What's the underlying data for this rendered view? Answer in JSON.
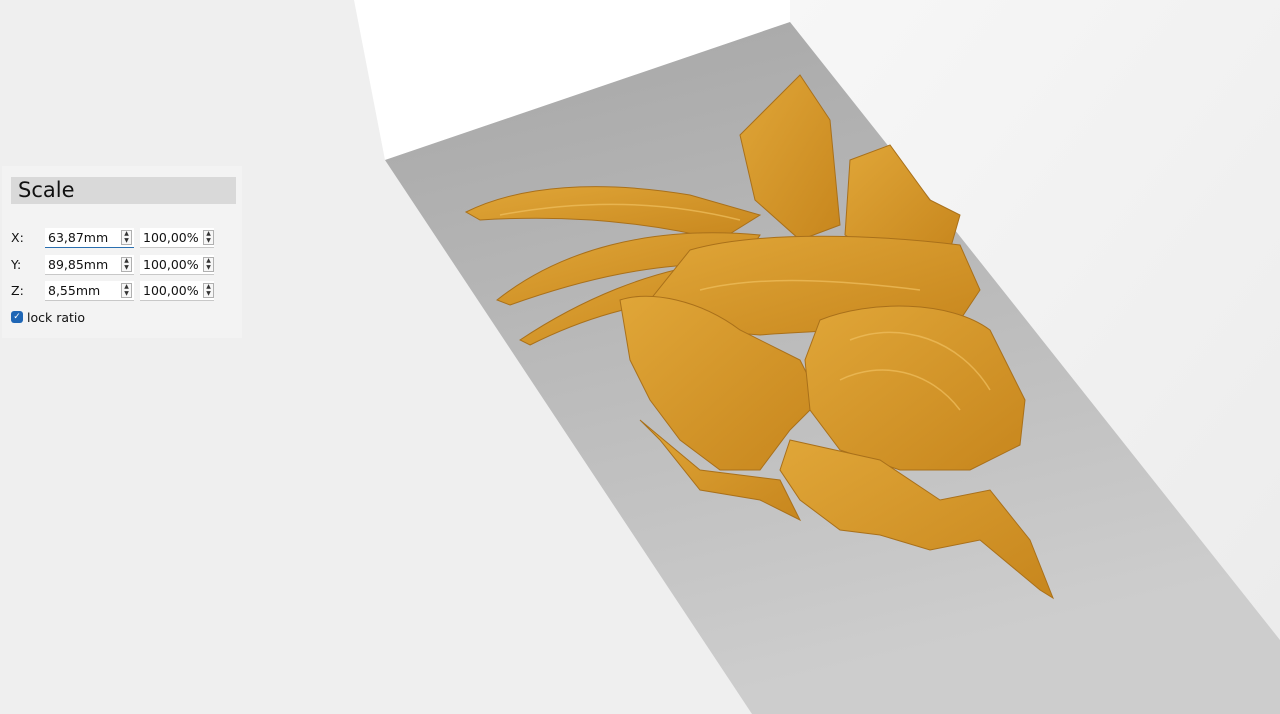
{
  "scale_panel": {
    "title": "Scale",
    "rows": [
      {
        "axis": "X:",
        "size": "63,87mm",
        "percent": "100,00%"
      },
      {
        "axis": "Y:",
        "size": "89,85mm",
        "percent": "100,00%"
      },
      {
        "axis": "Z:",
        "size": "8,55mm",
        "percent": "100,00%"
      }
    ],
    "lock_ratio_label": "lock ratio",
    "lock_ratio_checked": true
  },
  "colors": {
    "model": "#d9982a",
    "plate": "#b4b4b4",
    "accent": "#1f66b5"
  }
}
